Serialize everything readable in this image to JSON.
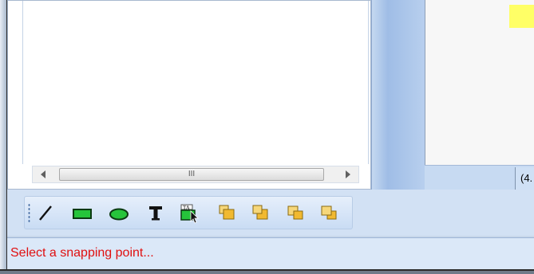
{
  "window": {
    "accent_color": "#c8d7ea",
    "right_panel_highlight_color": "#ffff66"
  },
  "left_panel": {
    "hscroll": {
      "thumb_grip_label": "III"
    }
  },
  "right_panel": {
    "status_cell_text": "(4."
  },
  "toolbar": {
    "tools": [
      {
        "name": "line-tool",
        "icon": "line-icon"
      },
      {
        "name": "rectangle-tool",
        "icon": "rectangle-icon"
      },
      {
        "name": "ellipse-tool",
        "icon": "ellipse-icon"
      },
      {
        "name": "text-tool",
        "icon": "text-icon"
      },
      {
        "name": "text-image-tool",
        "icon": "text-image-icon"
      },
      {
        "name": "bring-to-front-tool",
        "icon": "bring-to-front-icon"
      },
      {
        "name": "send-to-back-tool",
        "icon": "send-to-back-icon"
      },
      {
        "name": "bring-forward-tool",
        "icon": "bring-forward-icon"
      },
      {
        "name": "send-backward-tool",
        "icon": "send-backward-icon"
      }
    ]
  },
  "status_bar": {
    "message": "Select a snapping point...",
    "message_color": "#e01010"
  }
}
